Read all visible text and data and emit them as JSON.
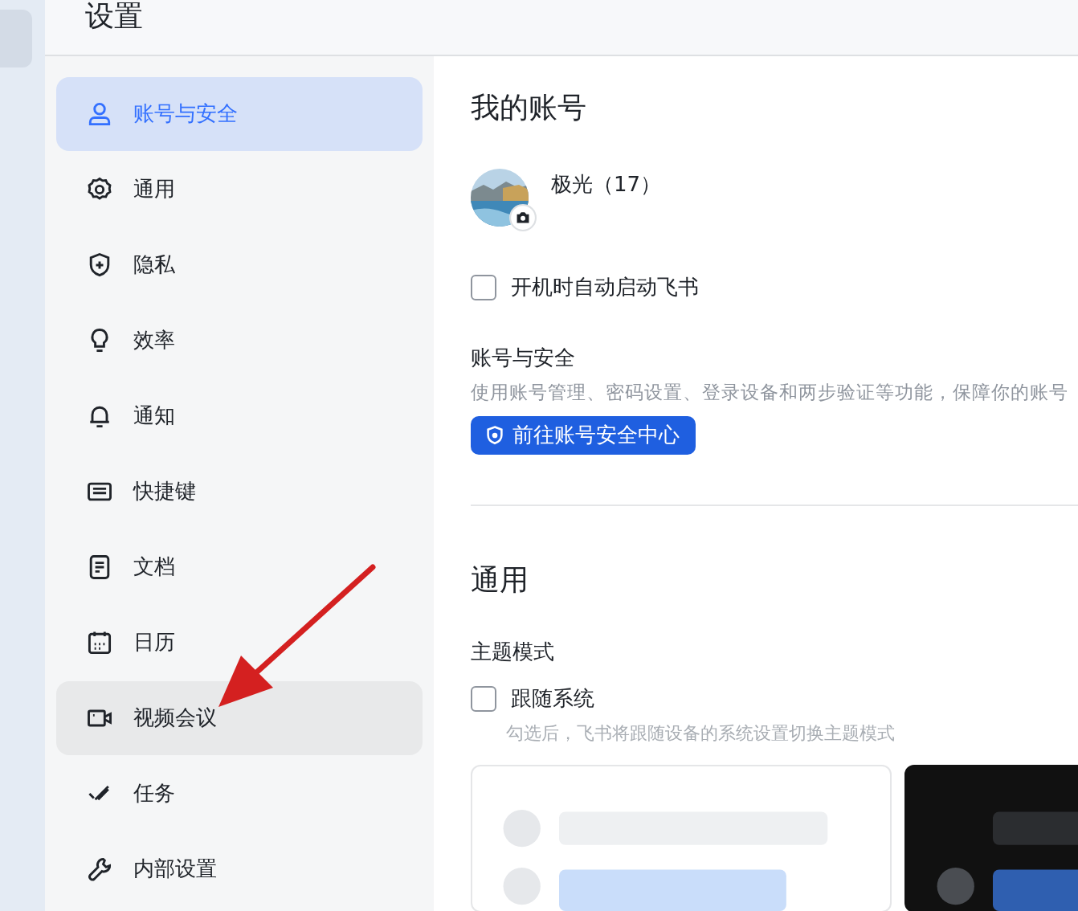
{
  "window": {
    "title": "设置"
  },
  "sidebar": {
    "items": [
      {
        "label": "账号与安全",
        "selected": true,
        "hovered": false
      },
      {
        "label": "通用",
        "selected": false,
        "hovered": false
      },
      {
        "label": "隐私",
        "selected": false,
        "hovered": false
      },
      {
        "label": "效率",
        "selected": false,
        "hovered": false
      },
      {
        "label": "通知",
        "selected": false,
        "hovered": false
      },
      {
        "label": "快捷键",
        "selected": false,
        "hovered": false
      },
      {
        "label": "文档",
        "selected": false,
        "hovered": false
      },
      {
        "label": "日历",
        "selected": false,
        "hovered": false
      },
      {
        "label": "视频会议",
        "selected": false,
        "hovered": true
      },
      {
        "label": "任务",
        "selected": false,
        "hovered": false
      },
      {
        "label": "内部设置",
        "selected": false,
        "hovered": false
      }
    ]
  },
  "account": {
    "heading": "我的账号",
    "name": "极光（17）",
    "autostart": {
      "label": "开机时自动启动飞书",
      "checked": false
    },
    "security": {
      "title": "账号与安全",
      "description": "使用账号管理、密码设置、登录设备和两步验证等功能，保障你的账号",
      "button": "前往账号安全中心"
    }
  },
  "general": {
    "heading": "通用",
    "theme": {
      "title": "主题模式",
      "follow_system": {
        "label": "跟随系统",
        "checked": false
      },
      "hint": "勾选后，飞书将跟随设备的系统设置切换主题模式",
      "previews": [
        {
          "kind": "light"
        },
        {
          "kind": "dark"
        }
      ]
    }
  }
}
